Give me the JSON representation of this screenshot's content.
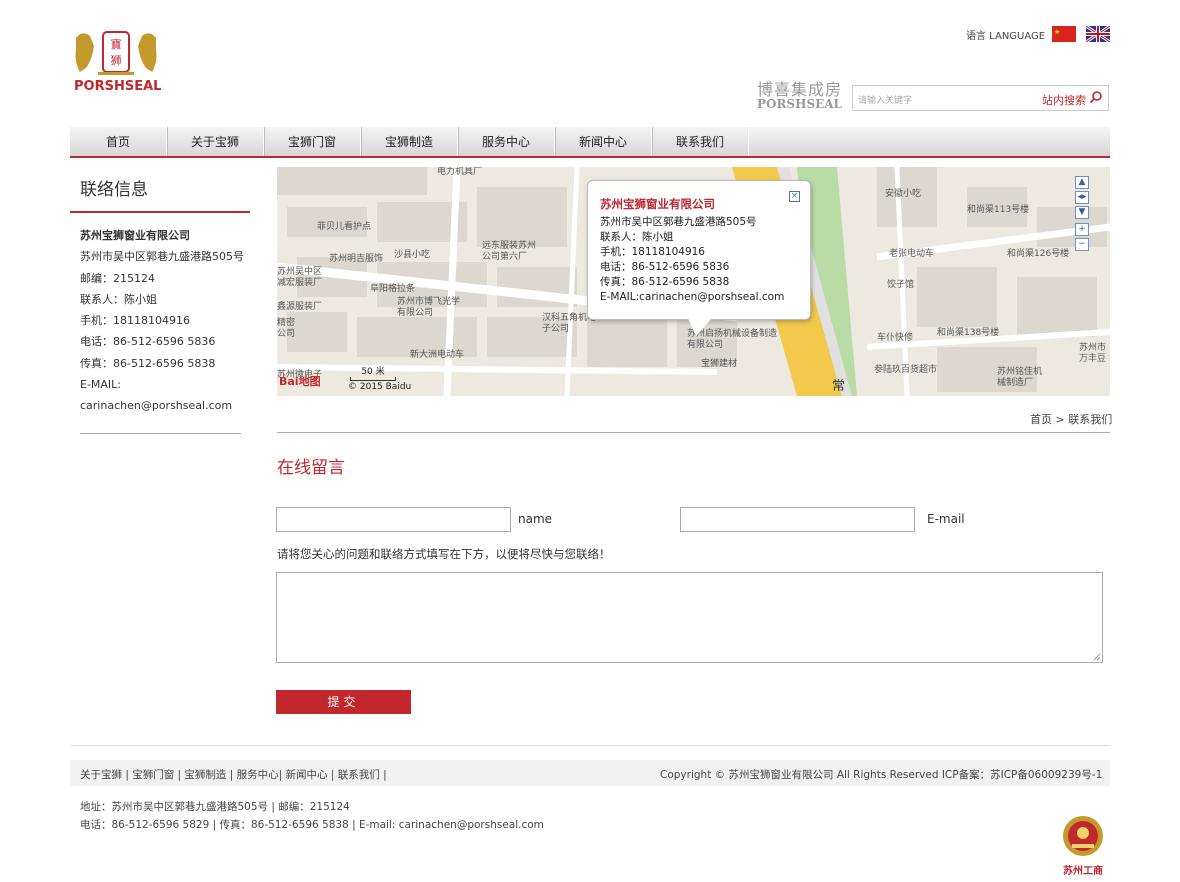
{
  "header": {
    "logo_text": "PORSHSEAL",
    "lang_label": "语言 LANGUAGE",
    "brand_cn": "博喜集成房",
    "brand_en": "PORSHSEAL",
    "search_placeholder": "请输入关键字",
    "search_label": "站内搜索"
  },
  "nav": [
    "首页",
    "关于宝狮",
    "宝狮门窗",
    "宝狮制造",
    "服务中心",
    "新闻中心",
    "联系我们"
  ],
  "sidebar": {
    "title": "联络信息",
    "company": "苏州宝狮窗业有限公司",
    "address": "苏州市吴中区郭巷九盛港路505号",
    "postcode": "邮编：215124",
    "contact": "联系人：陈小姐",
    "mobile": "手机：18118104916",
    "phone": "电话：86-512-6596 5836",
    "fax": "传真：86-512-6596 5838",
    "email_label": "E-MAIL:",
    "email": "carinachen@porshseal.com"
  },
  "map": {
    "popup": {
      "title": "苏州宝狮窗业有限公司",
      "address": "苏州市吴中区郭巷九盛港路505号",
      "contact": "联系人：陈小姐",
      "mobile": "手机：18118104916",
      "phone": "电话：86-512-6596 5836",
      "fax": "传真：86-512-6596 5838",
      "email": "E-MAIL:carinachen@porshseal.com"
    },
    "pois": [
      "电力机具厂",
      "菲贝儿看护点",
      "苏州明吉服饰",
      "沙县小吃",
      "远东服装苏州公司第六厂",
      "苏州吴中区减宏服装厂",
      "阜阳格拉条",
      "鑫源服装厂",
      "苏州市博飞光学有限公司",
      "汉科五角机电子公司",
      "精密公司",
      "新大洲电动车",
      "苏州微电子",
      "苏州启扬机械设备制造有限公司",
      "宝狮建材",
      "安徽小吃",
      "和尚渠113号楼",
      "老张电动车",
      "和尚渠126号楼",
      "饺子馆",
      "车仆快修",
      "和尚渠138号楼",
      "参陆玖百货超市",
      "苏州铭佳机械制造厂",
      "苏州市万丰豆"
    ],
    "scale": "50 米",
    "logo": "Bai地图",
    "copyright": "© 2015 Baidu",
    "road_label": "常"
  },
  "breadcrumb": "首页 > 联系我们",
  "form": {
    "title": "在线留言",
    "name_label": "name",
    "email_label": "E-mail",
    "hint": "请将您关心的问题和联络方式填写在下方，以便将尽快与您联络！",
    "submit": "提交"
  },
  "footer": {
    "links": "关于宝狮 | 宝狮门窗 | 宝狮制造 | 服务中心| 新闻中心 | 联系我们 |",
    "copyright": "Copyright © 苏州宝狮窗业有限公司 All Rights Reserved ICP备案：苏ICP备06009239号-1",
    "address": "地址：苏州市吴中区郭巷九盛港路505号 | 邮编：215124",
    "contact": "电话：86-512-6596 5829 | 传真：86-512-6596 5838 | E-mail: carinachen@porshseal.com",
    "badge": "苏州工商"
  },
  "colors": {
    "accent": "#c1272d",
    "gold": "#c49a2c"
  }
}
